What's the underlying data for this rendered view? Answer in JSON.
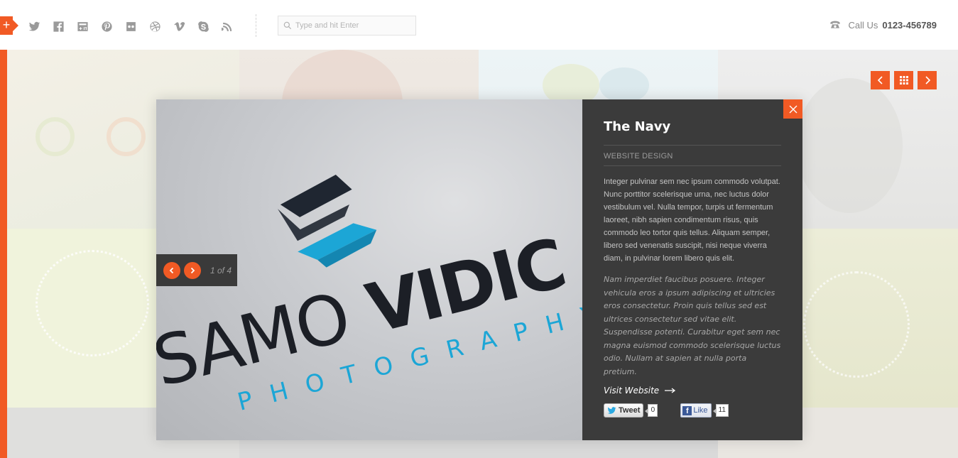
{
  "header": {
    "social_icons": [
      "twitter-icon",
      "facebook-icon",
      "google-plus-icon",
      "pinterest-icon",
      "flickr-icon",
      "dribbble-icon",
      "vimeo-icon",
      "skype-icon",
      "rss-icon"
    ],
    "search": {
      "placeholder": "Type and hit Enter"
    },
    "call_label": "Call Us",
    "phone": "0123-456789"
  },
  "portfolio_nav": {
    "prev_icon": "chevron-left-icon",
    "grid_icon": "grid-icon",
    "next_icon": "chevron-right-icon"
  },
  "modal": {
    "title": "The Navy",
    "category": "WEBSITE DESIGN",
    "description": "Integer pulvinar sem nec ipsum commodo volutpat. Nunc porttitor scelerisque urna, nec luctus dolor vestibulum vel. Nulla tempor, turpis ut fermentum laoreet, nibh sapien condimentum risus, quis commodo leo tortor quis tellus. Aliquam semper, libero sed venenatis suscipit, nisi neque viverra diam, in pulvinar lorem libero quis elit.",
    "description_italic": "Nam imperdiet faucibus posuere. Integer vehicula eros a ipsum adipiscing et ultricies eros consectetur. Proin quis tellus sed est ultrices consectetur sed vitae elit. Suspendisse potenti. Curabitur eget sem nec magna euismod commodo scelerisque luctus odio. Nullam at sapien at nulla porta pretium.",
    "visit_label": "Visit Website",
    "slide_counter": "1 of 4",
    "photo": {
      "logo_word_left": "SAMO",
      "logo_word_right": "VIDIC",
      "logo_sub": "PHOTOGRAPHY"
    },
    "share": {
      "tweet_label": "Tweet",
      "tweet_count": "0",
      "like_label": "Like",
      "like_count": "11"
    }
  },
  "colors": {
    "accent": "#f15a24",
    "panel": "#3b3b3b"
  }
}
